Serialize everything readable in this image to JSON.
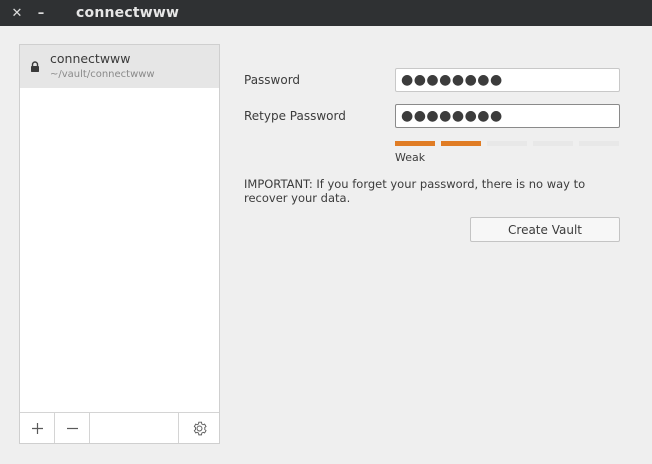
{
  "window": {
    "title": "connectwww",
    "close_glyph": "✕",
    "minimize_glyph": "–"
  },
  "sidebar": {
    "vaults": [
      {
        "name": "connectwww",
        "path": "~/vault/connectwww",
        "icon": "lock-icon"
      }
    ],
    "footer": {
      "add_glyph": "+",
      "remove_glyph": "−",
      "settings_icon": "gear-icon"
    }
  },
  "form": {
    "password_label": "Password",
    "password_value": "●●●●●●●●",
    "retype_label": "Retype Password",
    "retype_value": "●●●●●●●●",
    "strength": {
      "label": "Weak",
      "level": 2,
      "segments": 5,
      "active_color": "#e07c24",
      "inactive_color": "#e8e8e8"
    },
    "warning": "IMPORTANT: If you forget your password, there is no way to recover your data.",
    "create_button": "Create Vault"
  }
}
